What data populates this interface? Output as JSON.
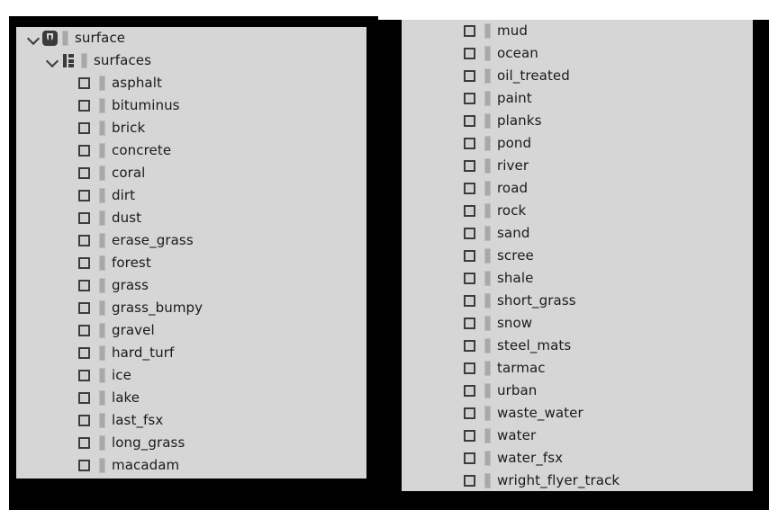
{
  "theme": {
    "page_background": "#ffffff",
    "backdrop_color": "#000000",
    "panel_background": "#d6d6d6",
    "text_color": "#1a1a1a",
    "icon_color": "#3b3b3b",
    "swatch_color": "#a8a8a8"
  },
  "tree": {
    "root": {
      "label": "surface",
      "icon": "object-node-icon",
      "expander": "chevron-down-icon",
      "expanded": true
    },
    "group": {
      "label": "surfaces",
      "icon": "list-node-icon",
      "expander": "chevron-down-icon",
      "expanded": true
    },
    "left_column": [
      {
        "label": "asphalt",
        "checked": false
      },
      {
        "label": "bituminus",
        "checked": false
      },
      {
        "label": "brick",
        "checked": false
      },
      {
        "label": "concrete",
        "checked": false
      },
      {
        "label": "coral",
        "checked": false
      },
      {
        "label": "dirt",
        "checked": false
      },
      {
        "label": "dust",
        "checked": false
      },
      {
        "label": "erase_grass",
        "checked": false
      },
      {
        "label": "forest",
        "checked": false
      },
      {
        "label": "grass",
        "checked": false
      },
      {
        "label": "grass_bumpy",
        "checked": false
      },
      {
        "label": "gravel",
        "checked": false
      },
      {
        "label": "hard_turf",
        "checked": false
      },
      {
        "label": "ice",
        "checked": false
      },
      {
        "label": "lake",
        "checked": false
      },
      {
        "label": "last_fsx",
        "checked": false
      },
      {
        "label": "long_grass",
        "checked": false
      },
      {
        "label": "macadam",
        "checked": false
      }
    ],
    "right_column": [
      {
        "label": "mud",
        "checked": false
      },
      {
        "label": "ocean",
        "checked": false
      },
      {
        "label": "oil_treated",
        "checked": false
      },
      {
        "label": "paint",
        "checked": false
      },
      {
        "label": "planks",
        "checked": false
      },
      {
        "label": "pond",
        "checked": false
      },
      {
        "label": "river",
        "checked": false
      },
      {
        "label": "road",
        "checked": false
      },
      {
        "label": "rock",
        "checked": false
      },
      {
        "label": "sand",
        "checked": false
      },
      {
        "label": "scree",
        "checked": false
      },
      {
        "label": "shale",
        "checked": false
      },
      {
        "label": "short_grass",
        "checked": false
      },
      {
        "label": "snow",
        "checked": false
      },
      {
        "label": "steel_mats",
        "checked": false
      },
      {
        "label": "tarmac",
        "checked": false
      },
      {
        "label": "urban",
        "checked": false
      },
      {
        "label": "waste_water",
        "checked": false
      },
      {
        "label": "water",
        "checked": false
      },
      {
        "label": "water_fsx",
        "checked": false
      },
      {
        "label": "wright_flyer_track",
        "checked": false
      }
    ]
  }
}
